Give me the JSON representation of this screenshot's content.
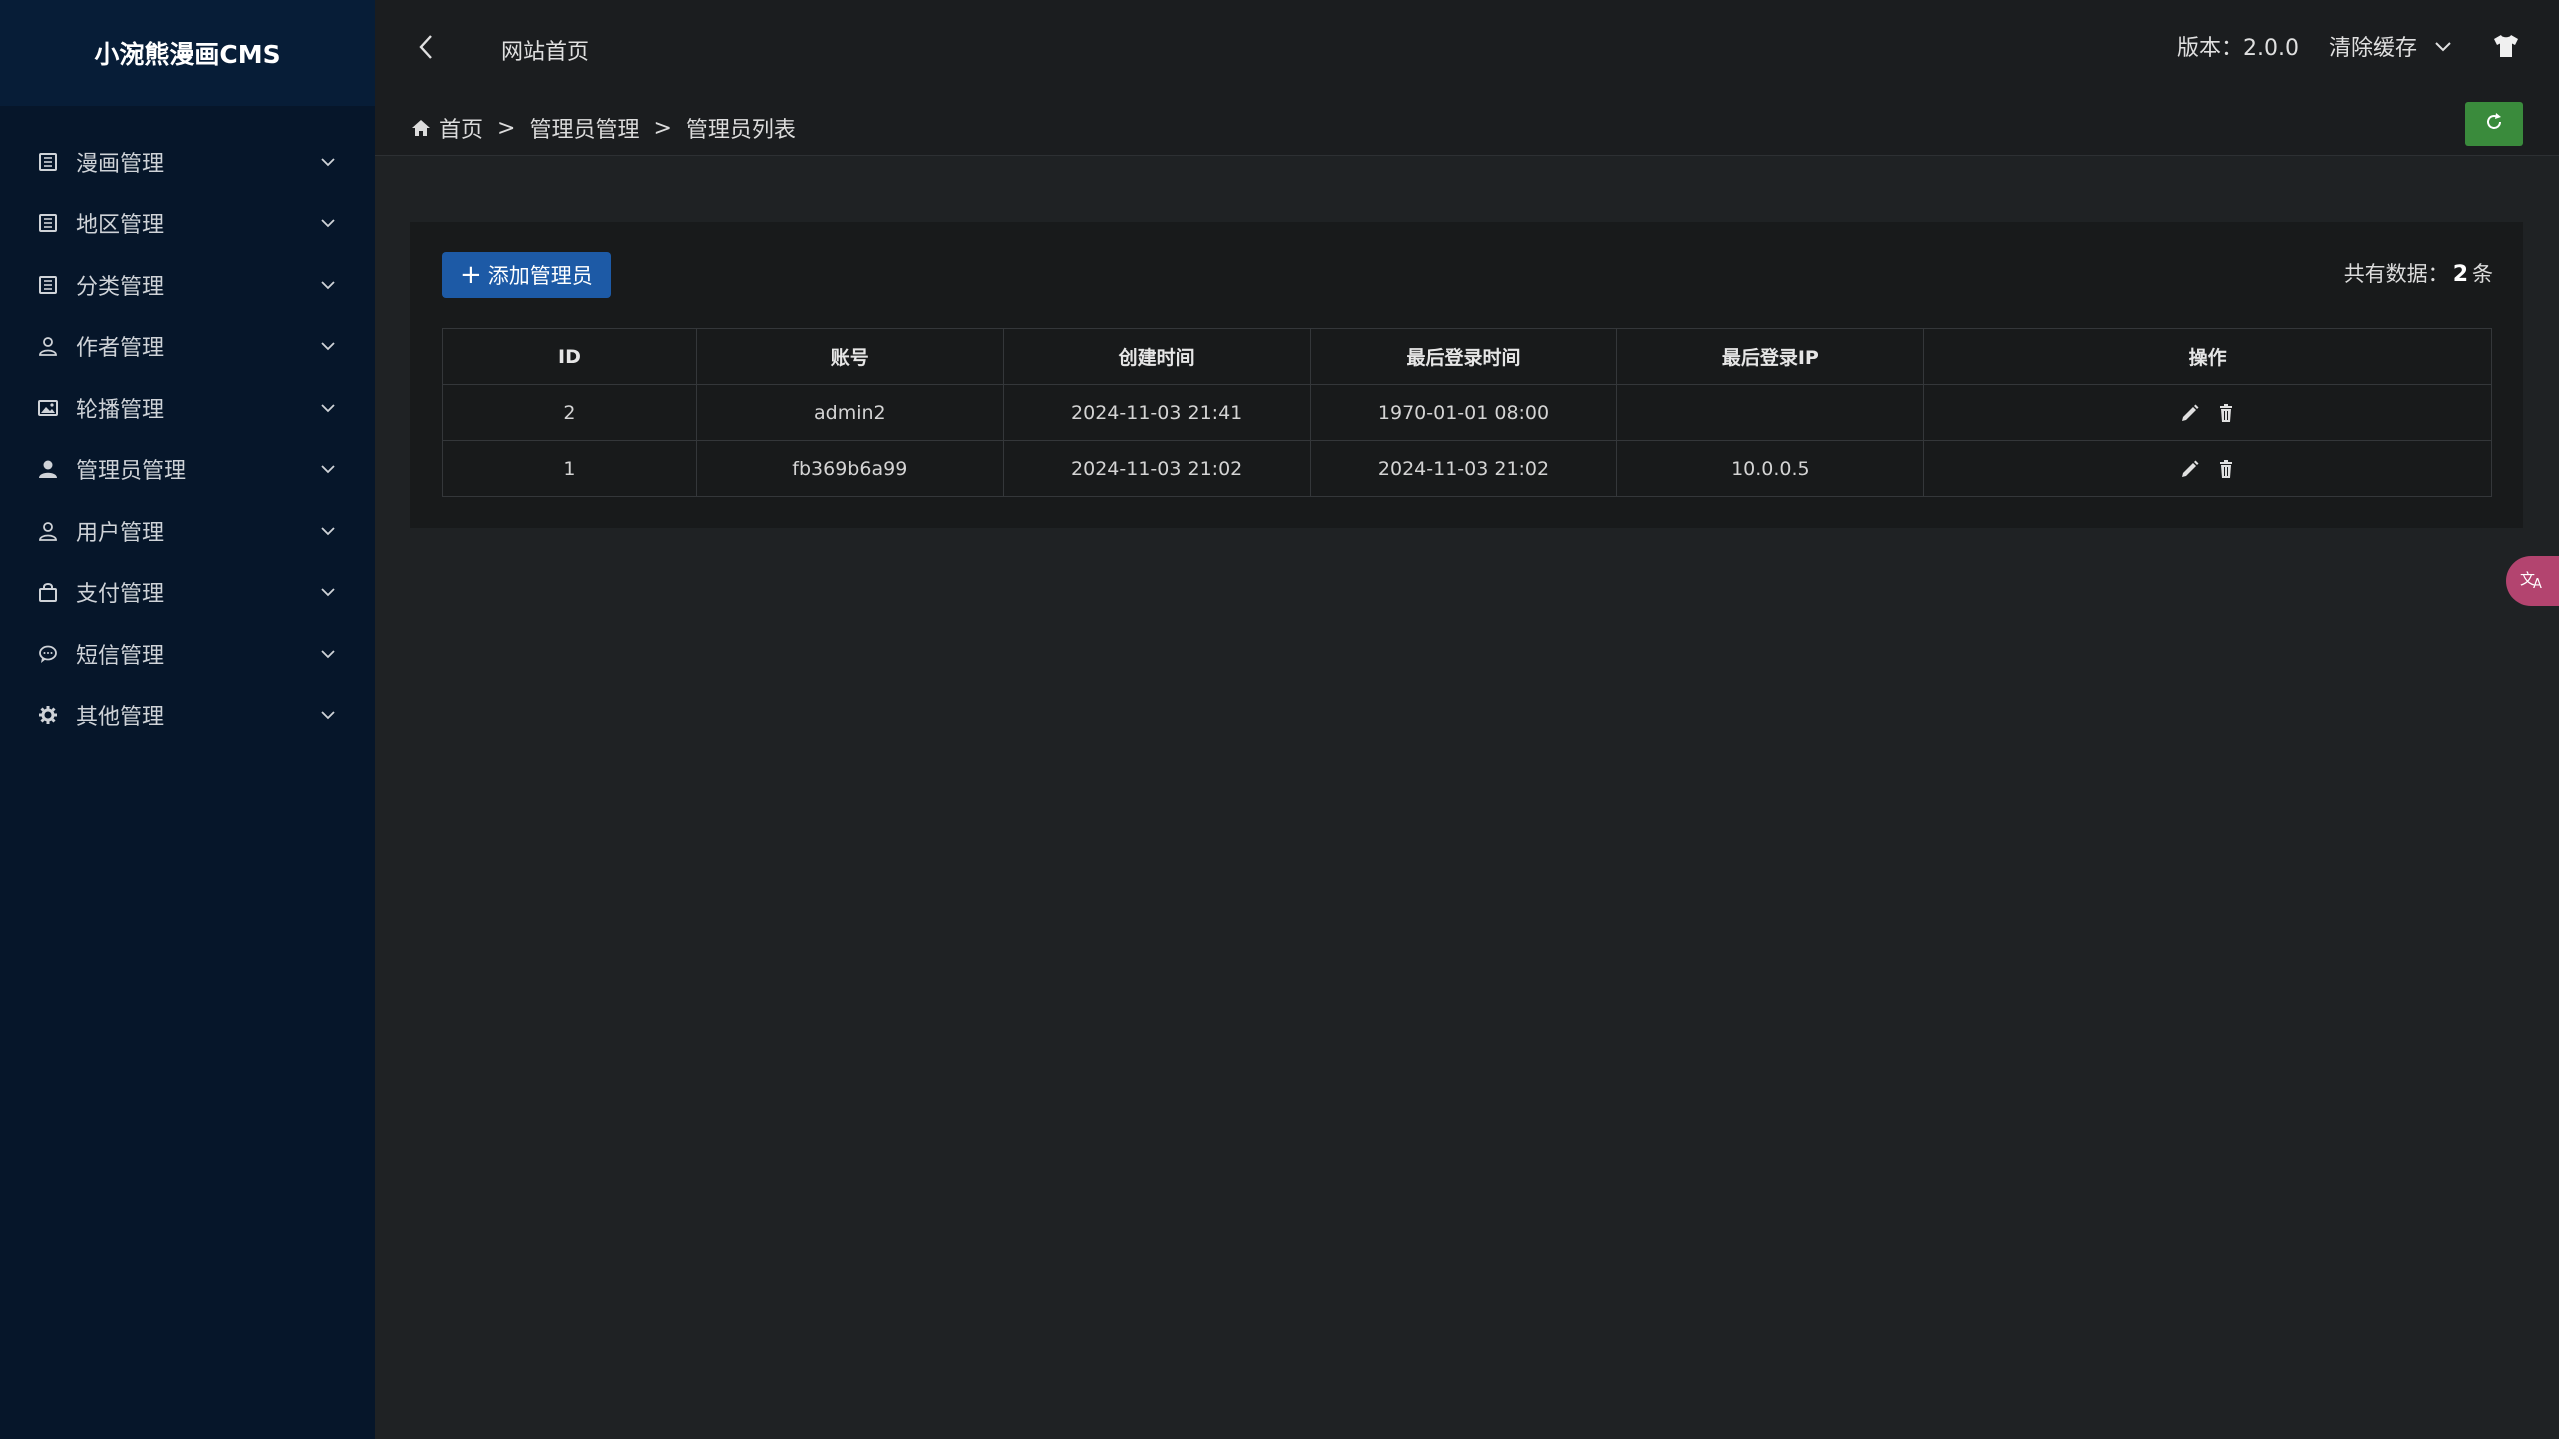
{
  "sidebar": {
    "brand": "小涴熊漫画CMS",
    "items": [
      {
        "label": "漫画管理",
        "icon": "book-icon"
      },
      {
        "label": "地区管理",
        "icon": "book-icon"
      },
      {
        "label": "分类管理",
        "icon": "book-icon"
      },
      {
        "label": "作者管理",
        "icon": "user-outline-icon"
      },
      {
        "label": "轮播管理",
        "icon": "image-icon"
      },
      {
        "label": "管理员管理",
        "icon": "user-solid-icon"
      },
      {
        "label": "用户管理",
        "icon": "user-outline-icon"
      },
      {
        "label": "支付管理",
        "icon": "shopping-bag-icon"
      },
      {
        "label": "短信管理",
        "icon": "chat-bubble-icon"
      },
      {
        "label": "其他管理",
        "icon": "gear-icon"
      }
    ]
  },
  "topbar": {
    "home_link": "网站首页",
    "version": "版本：2.0.0",
    "clear_cache": "清除缓存"
  },
  "breadcrumb": {
    "home": "首页",
    "sep": ">",
    "level1": "管理员管理",
    "level2": "管理员列表"
  },
  "panel": {
    "add_button": "添加管理员",
    "total_prefix": "共有数据：",
    "total_count": "2",
    "total_suffix": "条"
  },
  "table": {
    "headers": [
      "ID",
      "账号",
      "创建时间",
      "最后登录时间",
      "最后登录IP",
      "操作"
    ],
    "rows": [
      {
        "id": "2",
        "account": "admin2",
        "created": "2024-11-03 21:41",
        "last_login": "1970-01-01 08:00",
        "last_ip": ""
      },
      {
        "id": "1",
        "account": "fb369b6a99",
        "created": "2024-11-03 21:02",
        "last_login": "2024-11-03 21:02",
        "last_ip": "10.0.0.5"
      }
    ]
  },
  "colors": {
    "sidebar_bg": "#06162a",
    "primary": "#1d5aa6",
    "success": "#3a8b3c",
    "fab": "#b3446f"
  }
}
